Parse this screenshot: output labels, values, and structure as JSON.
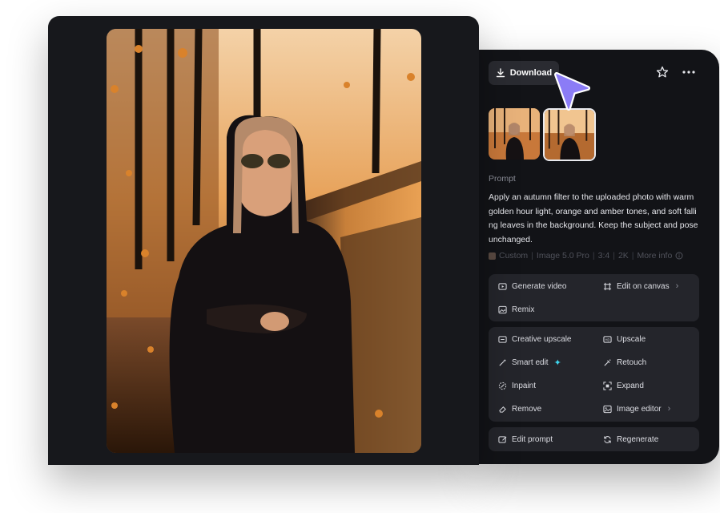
{
  "toolbar": {
    "download_label": "Download"
  },
  "icons": {
    "download": "download-icon",
    "favorite": "star-icon",
    "more": "more-options-icon",
    "cursor": "pointer-cursor-icon"
  },
  "prompt": {
    "label": "Prompt",
    "text": "Apply an autumn filter to the uploaded photo with warm golden hour light, orange and amber tones, and soft falli ng leaves in the background. Keep the subject and pose unchanged."
  },
  "meta": {
    "style": "Custom",
    "model": "Image 5.0 Pro",
    "ratio": "3:4",
    "resolution": "2K",
    "more_info": "More info"
  },
  "actions": {
    "generate_video": "Generate video",
    "edit_on_canvas": "Edit on canvas",
    "remix": "Remix",
    "creative_upscale": "Creative upscale",
    "upscale": "Upscale",
    "smart_edit": "Smart edit",
    "retouch": "Retouch",
    "inpaint": "Inpaint",
    "expand": "Expand",
    "remove": "Remove",
    "image_editor": "Image editor",
    "edit_prompt": "Edit prompt",
    "regenerate": "Regenerate"
  },
  "colors": {
    "panel_bg": "#121317",
    "card_bg": "#17181c",
    "group_bg": "#24252b",
    "accent_cursor": "#8b7cf6",
    "sparkle": "#3fd7ef"
  }
}
